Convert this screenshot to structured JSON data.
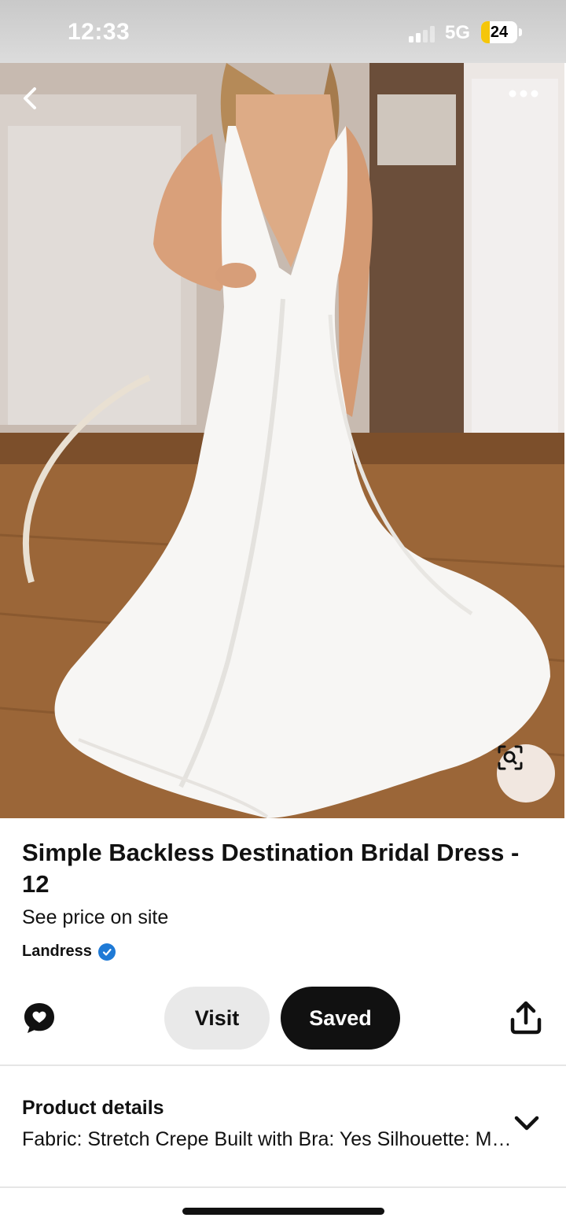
{
  "status_bar": {
    "time": "12:33",
    "network": "5G",
    "battery": "24",
    "battery_level": 0.24
  },
  "hero": {
    "back_icon": "chevron-left-icon",
    "more_icon": "ellipsis-icon",
    "lens_icon": "visual-search-icon"
  },
  "product": {
    "title": "Simple Backless Destination Bridal Dress - 12",
    "price_text": "See price on site",
    "seller": "Landress",
    "seller_verified": true
  },
  "actions": {
    "comment_icon": "comment-heart-icon",
    "visit_label": "Visit",
    "saved_label": "Saved",
    "share_icon": "share-icon"
  },
  "details": {
    "title": "Product details",
    "text": "Fabric: Stretch Crepe Built with Bra: Yes Silhouette: Mermaid",
    "expand_icon": "chevron-down-icon"
  },
  "colors": {
    "primary_button": "#111111",
    "secondary_button": "#e9e9e9",
    "verified_badge": "#1f7ad6",
    "battery_fill": "#f5c60a"
  }
}
